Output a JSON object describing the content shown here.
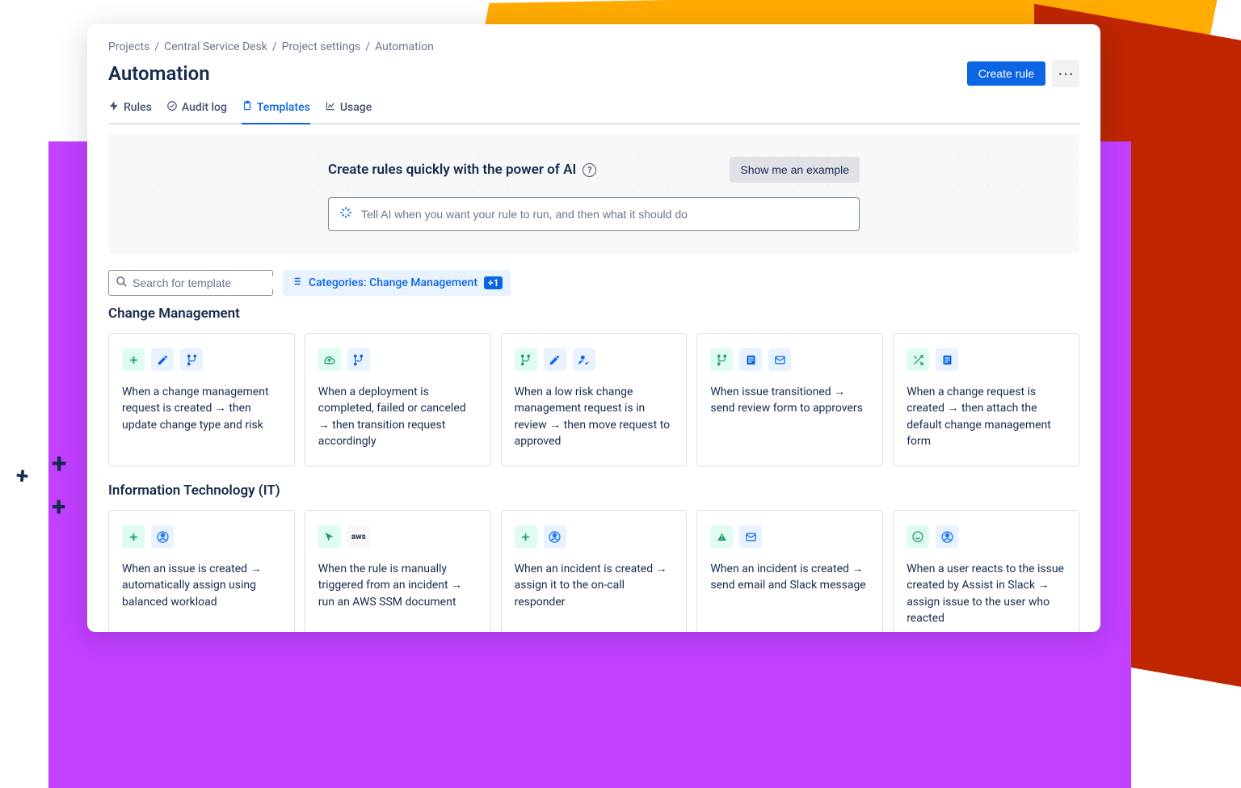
{
  "breadcrumb": {
    "items": [
      "Projects",
      "Central Service Desk",
      "Project settings",
      "Automation"
    ]
  },
  "header": {
    "title": "Automation",
    "create_rule": "Create rule"
  },
  "tabs": {
    "rules": "Rules",
    "audit": "Audit log",
    "templates": "Templates",
    "usage": "Usage"
  },
  "ai": {
    "heading": "Create rules quickly with the power of AI",
    "show_example": "Show me an example",
    "placeholder": "Tell AI when you want your rule to run, and then what it should do"
  },
  "filters": {
    "search_placeholder": "Search for template",
    "category_label": "Categories: Change Management",
    "category_badge": "+1"
  },
  "sections": {
    "change": {
      "title": "Change Management",
      "cards": [
        "When a change management request is created → then update change type and risk",
        "When a deployment is completed, failed or canceled → then transition request accordingly",
        "When a low risk change management request is in review → then move request to approved",
        "When issue transitioned → send review form to approvers",
        "When a change request is created → then attach the default change management form"
      ]
    },
    "it": {
      "title": "Information Technology (IT)",
      "cards": [
        "When an issue is created → automatically assign using balanced workload",
        "When the rule is manually triggered from an incident → run an AWS SSM document",
        "When an incident is created → assign it to the on-call responder",
        "When an incident is created → send email and Slack message",
        "When a user reacts to the issue created by Assist in Slack → assign issue to the user who reacted"
      ]
    }
  }
}
